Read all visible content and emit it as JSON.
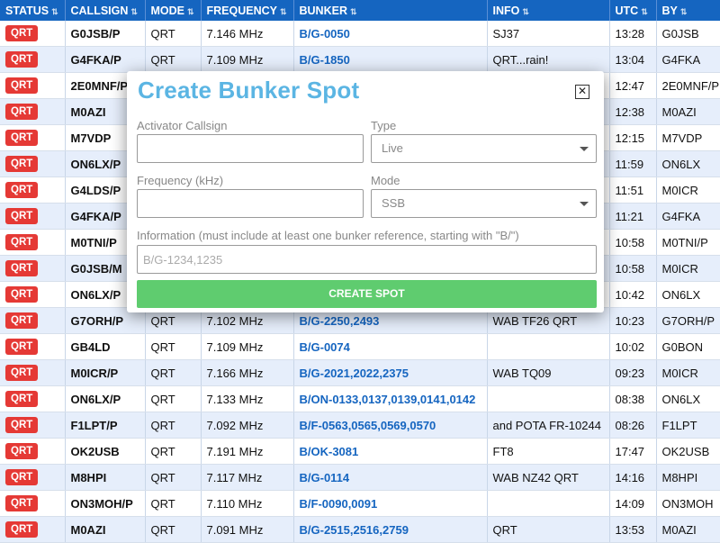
{
  "table": {
    "headers": [
      "STATUS",
      "CALLSIGN",
      "MODE",
      "FREQUENCY",
      "BUNKER",
      "INFO",
      "UTC",
      "BY"
    ],
    "sort_glyph": "⇅",
    "rows": [
      {
        "status": "QRT",
        "callsign": "G0JSB/P",
        "mode": "QRT",
        "freq": "7.146 MHz",
        "bunker": "B/G-0050",
        "info": "SJ37",
        "utc": "13:28",
        "by": "G0JSB"
      },
      {
        "status": "QRT",
        "callsign": "G4FKA/P",
        "mode": "QRT",
        "freq": "7.109 MHz",
        "bunker": "B/G-1850",
        "info": "QRT...rain!",
        "utc": "13:04",
        "by": "G4FKA"
      },
      {
        "status": "QRT",
        "callsign": "2E0MNF/P",
        "mode": "",
        "freq": "",
        "bunker": "",
        "info": "",
        "utc": "12:47",
        "by": "2E0MNF/P"
      },
      {
        "status": "QRT",
        "callsign": "M0AZI",
        "mode": "",
        "freq": "",
        "bunker": "",
        "info": "",
        "utc": "12:38",
        "by": "M0AZI"
      },
      {
        "status": "QRT",
        "callsign": "M7VDP",
        "mode": "",
        "freq": "",
        "bunker": "",
        "info": "",
        "utc": "12:15",
        "by": "M7VDP"
      },
      {
        "status": "QRT",
        "callsign": "ON6LX/P",
        "mode": "",
        "freq": "",
        "bunker": "",
        "info": "",
        "utc": "11:59",
        "by": "ON6LX"
      },
      {
        "status": "QRT",
        "callsign": "G4LDS/P",
        "mode": "",
        "freq": "",
        "bunker": "",
        "info": "",
        "utc": "11:51",
        "by": "M0ICR"
      },
      {
        "status": "QRT",
        "callsign": "G4FKA/P",
        "mode": "",
        "freq": "",
        "bunker": "",
        "info": "",
        "utc": "11:21",
        "by": "G4FKA"
      },
      {
        "status": "QRT",
        "callsign": "M0TNI/P",
        "mode": "",
        "freq": "",
        "bunker": "",
        "info": "",
        "utc": "10:58",
        "by": "M0TNI/P"
      },
      {
        "status": "QRT",
        "callsign": "G0JSB/M",
        "mode": "",
        "freq": "",
        "bunker": "",
        "info": "",
        "utc": "10:58",
        "by": "M0ICR"
      },
      {
        "status": "QRT",
        "callsign": "ON6LX/P",
        "mode": "",
        "freq": "",
        "bunker": "",
        "info": "",
        "utc": "10:42",
        "by": "ON6LX"
      },
      {
        "status": "QRT",
        "callsign": "G7ORH/P",
        "mode": "QRT",
        "freq": "7.102 MHz",
        "bunker": "B/G-2250,2493",
        "info": "WAB TF26 QRT",
        "utc": "10:23",
        "by": "G7ORH/P"
      },
      {
        "status": "QRT",
        "callsign": "GB4LD",
        "mode": "QRT",
        "freq": "7.109 MHz",
        "bunker": "B/G-0074",
        "info": "",
        "utc": "10:02",
        "by": "G0BON"
      },
      {
        "status": "QRT",
        "callsign": "M0ICR/P",
        "mode": "QRT",
        "freq": "7.166 MHz",
        "bunker": "B/G-2021,2022,2375",
        "info": "WAB TQ09",
        "utc": "09:23",
        "by": "M0ICR"
      },
      {
        "status": "QRT",
        "callsign": "ON6LX/P",
        "mode": "QRT",
        "freq": "7.133 MHz",
        "bunker": "B/ON-0133,0137,0139,0141,0142",
        "info": "",
        "utc": "08:38",
        "by": "ON6LX"
      },
      {
        "status": "QRT",
        "callsign": "F1LPT/P",
        "mode": "QRT",
        "freq": "7.092 MHz",
        "bunker": "B/F-0563,0565,0569,0570",
        "info": "and POTA FR-10244",
        "utc": "08:26",
        "by": "F1LPT"
      },
      {
        "status": "QRT",
        "callsign": "OK2USB",
        "mode": "QRT",
        "freq": "7.191 MHz",
        "bunker": "B/OK-3081",
        "info": "FT8",
        "utc": "17:47",
        "by": "OK2USB"
      },
      {
        "status": "QRT",
        "callsign": "M8HPI",
        "mode": "QRT",
        "freq": "7.117 MHz",
        "bunker": "B/G-0114",
        "info": "WAB NZ42 QRT",
        "utc": "14:16",
        "by": "M8HPI"
      },
      {
        "status": "QRT",
        "callsign": "ON3MOH/P",
        "mode": "QRT",
        "freq": "7.110 MHz",
        "bunker": "B/F-0090,0091",
        "info": "",
        "utc": "14:09",
        "by": "ON3MOH"
      },
      {
        "status": "QRT",
        "callsign": "M0AZI",
        "mode": "QRT",
        "freq": "7.091 MHz",
        "bunker": "B/G-2515,2516,2759",
        "info": "QRT",
        "utc": "13:53",
        "by": "M0AZI"
      }
    ]
  },
  "modal": {
    "title": "Create Bunker Spot",
    "close_icon": "close-icon",
    "activator_label": "Activator Callsign",
    "activator_value": "",
    "type_label": "Type",
    "type_value": "Live",
    "frequency_label": "Frequency (kHz)",
    "frequency_value": "",
    "mode_label": "Mode",
    "mode_value": "SSB",
    "info_label": "Information (must include at least one bunker reference, starting with \"B/\")",
    "info_placeholder": "B/G-1234,1235",
    "info_value": "",
    "submit_label": "CREATE SPOT"
  },
  "colors": {
    "header_bg": "#1565c0",
    "qrt_badge": "#e53935",
    "bunker_link": "#1565c0",
    "title": "#5bb5e3",
    "submit": "#5fcc6f"
  }
}
